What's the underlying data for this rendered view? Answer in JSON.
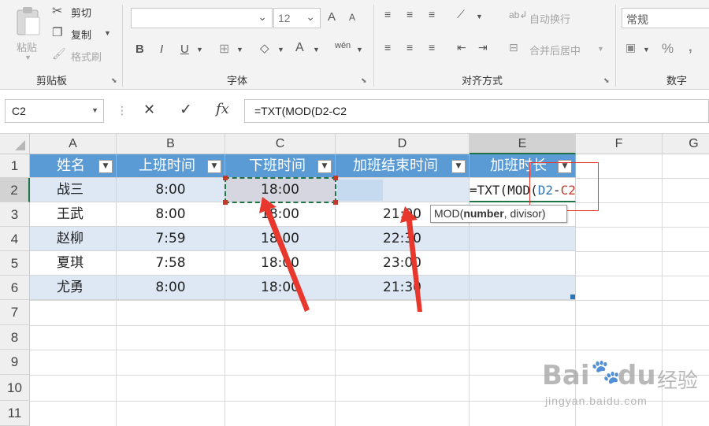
{
  "ribbon": {
    "clipboard": {
      "paste": "粘贴",
      "cut": "剪切",
      "copy": "复制",
      "format_painter": "格式刷",
      "label": "剪贴板"
    },
    "font": {
      "font_size": "12",
      "label": "字体",
      "bold": "B",
      "italic": "I",
      "underline": "U",
      "font_color": "A",
      "grow": "A",
      "shrink": "A"
    },
    "alignment": {
      "wrap_text": "自动换行",
      "merge_center": "合并后居中",
      "label": "对齐方式"
    },
    "number": {
      "format": "常规",
      "label": "数字",
      "percent": "%"
    }
  },
  "formula_bar": {
    "name_box": "C2",
    "cancel": "✕",
    "enter": "✓",
    "fx": "fx",
    "formula": "=TXT(MOD(D2-C2"
  },
  "columns": [
    "A",
    "B",
    "C",
    "D",
    "E",
    "F",
    "G"
  ],
  "rows": [
    "1",
    "2",
    "3",
    "4",
    "5",
    "6",
    "7",
    "8",
    "9",
    "10",
    "11"
  ],
  "table": {
    "headers": [
      "姓名",
      "上班时间",
      "下班时间",
      "加班结束时间",
      "加班时长"
    ],
    "data": [
      [
        "战三",
        "8:00",
        "18:00",
        "",
        ""
      ],
      [
        "王武",
        "8:00",
        "18:00",
        "21:00",
        ""
      ],
      [
        "赵柳",
        "7:59",
        "18:00",
        "22:30",
        ""
      ],
      [
        "夏琪",
        "7:58",
        "18:00",
        "23:00",
        ""
      ],
      [
        "尤勇",
        "8:00",
        "18:00",
        "21:30",
        ""
      ]
    ]
  },
  "edit_cell": {
    "prefix": "=TXT(MOD(",
    "ref1": "D2",
    "minus": "-",
    "ref2": "C2"
  },
  "tooltip": {
    "func": "MOD(",
    "arg_bold": "number",
    "rest": ", divisor)"
  },
  "watermark": {
    "brand": "Bai",
    "brand2": "du",
    "cn": "经验",
    "url": "jingyan.baidu.com"
  },
  "colors": {
    "header_blue": "#5b9bd5",
    "band": "#dde8f4",
    "arrow_red": "#e8372d",
    "ref_blue": "#2e75b6",
    "ref_red": "#c0392b"
  }
}
